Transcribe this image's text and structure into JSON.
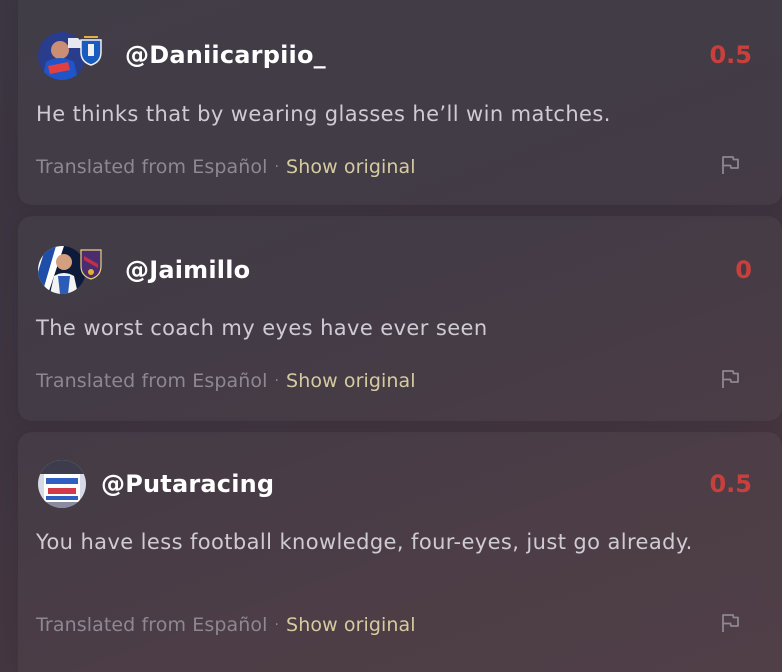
{
  "comments": [
    {
      "username": "@Daniicarpiio_",
      "score": "0.5",
      "text": "He thinks that by wearing glasses he’ll win matches.",
      "translated_label": "Translated from Español",
      "separator": "·",
      "show_original_label": "Show original",
      "avatar_icon": "user-avatar-icon",
      "badge_icon": "club-crest-icon",
      "flag_icon": "flag-icon"
    },
    {
      "username": "@Jaimillo",
      "score": "0",
      "text": "The worst coach my eyes have ever seen",
      "translated_label": "Translated from Español",
      "separator": "·",
      "show_original_label": "Show original",
      "avatar_icon": "user-avatar-icon",
      "badge_icon": "club-crest-icon",
      "flag_icon": "flag-icon"
    },
    {
      "username": "@Putaracing",
      "score": "0.5",
      "text": "You have less football knowledge, four-eyes, just go already.",
      "translated_label": "Translated from Español",
      "separator": "·",
      "show_original_label": "Show original",
      "avatar_icon": "user-avatar-icon",
      "flag_icon": "flag-icon"
    }
  ],
  "colors": {
    "score": "#c8403c",
    "username": "#ffffff",
    "comment_text": "#cfcbd3",
    "meta_text": "#8d8893",
    "show_original": "#d6cba0"
  }
}
